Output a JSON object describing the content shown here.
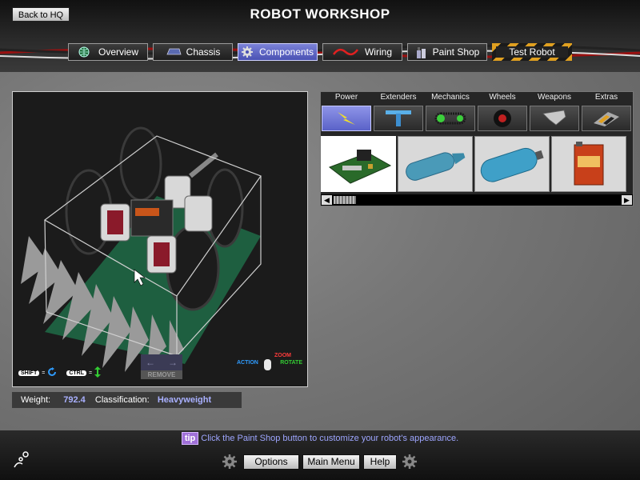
{
  "header": {
    "title": "ROBOT WORKSHOP",
    "back_label": "Back to HQ"
  },
  "tabs": [
    {
      "label": "Overview",
      "icon": "globe-icon",
      "active": false
    },
    {
      "label": "Chassis",
      "icon": "chassis-icon",
      "active": false
    },
    {
      "label": "Components",
      "icon": "gear-icon",
      "active": true
    },
    {
      "label": "Wiring",
      "icon": "wire-icon",
      "active": false
    },
    {
      "label": "Paint Shop",
      "icon": "paint-icon",
      "active": false
    },
    {
      "label": "Test Robot",
      "icon": "",
      "active": false
    }
  ],
  "viewport": {
    "shift_key": "SHIFT",
    "ctrl_key": "CTRL",
    "equals": "=",
    "remove_label": "REMOVE",
    "zoom_label": "ZOOM",
    "action_label": "ACTION",
    "rotate_label": "ROTATE"
  },
  "stats": {
    "weight_label": "Weight:",
    "weight_value": "792.4",
    "class_label": "Classification:",
    "class_value": "Heavyweight"
  },
  "categories": [
    {
      "label": "Power",
      "icon": "lightning-icon",
      "active": true
    },
    {
      "label": "Extenders",
      "icon": "extender-icon",
      "active": false
    },
    {
      "label": "Mechanics",
      "icon": "chain-icon",
      "active": false
    },
    {
      "label": "Wheels",
      "icon": "wheel-icon",
      "active": false
    },
    {
      "label": "Weapons",
      "icon": "weapon-icon",
      "active": false
    },
    {
      "label": "Extras",
      "icon": "extras-icon",
      "active": false
    }
  ],
  "items": [
    {
      "name": "circuit-board-icon",
      "selected": true
    },
    {
      "name": "blue-tank-icon",
      "selected": false
    },
    {
      "name": "co2-tank-icon",
      "selected": false
    },
    {
      "name": "battery-box-icon",
      "selected": false
    }
  ],
  "tip": {
    "tag": "tip",
    "text": "Click the Paint Shop button to customize your robot's appearance."
  },
  "bottom": {
    "options_label": "Options",
    "menu_label": "Main Menu",
    "help_label": "Help"
  },
  "colors": {
    "accent": "#5a62c8",
    "stat_value": "#a9b0ff",
    "tip_text": "#9ea6ff"
  }
}
